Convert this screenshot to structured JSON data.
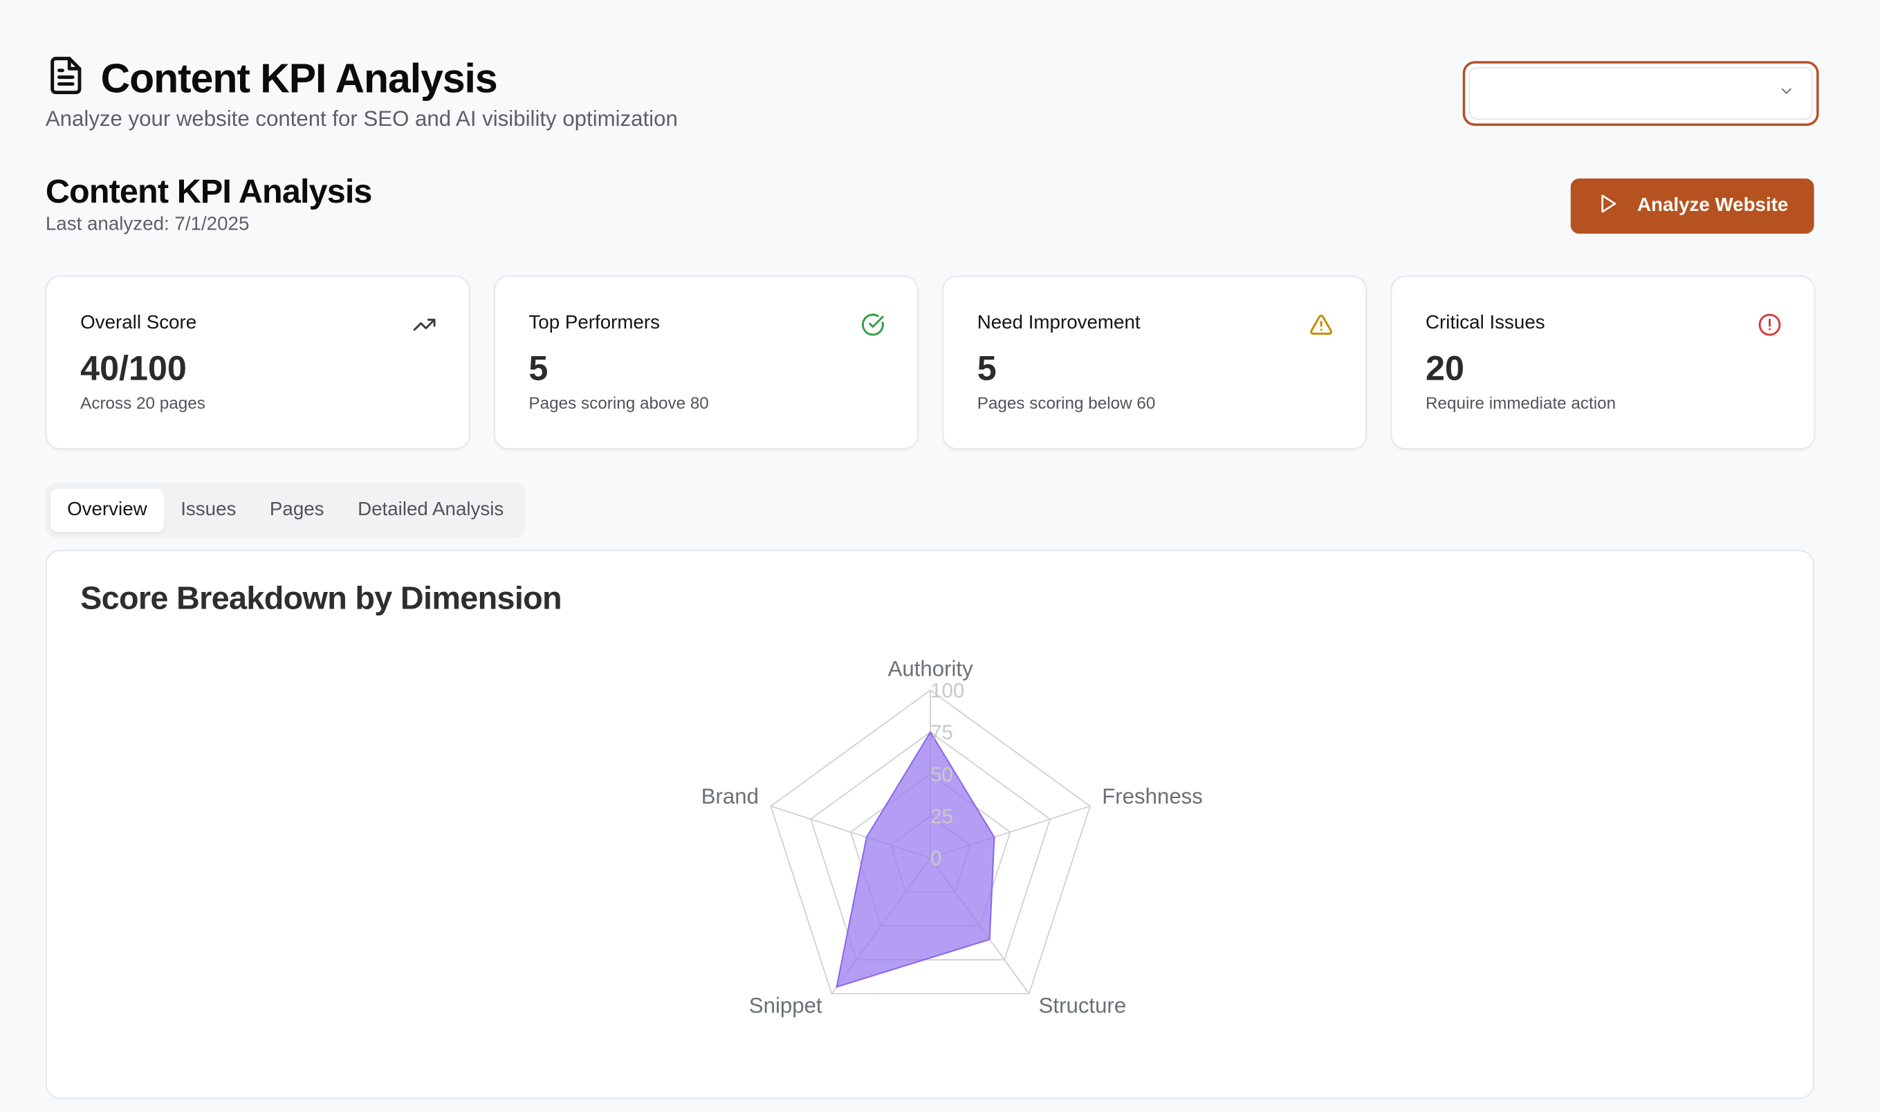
{
  "header": {
    "title": "Content KPI Analysis",
    "subtitle": "Analyze your website content for SEO and AI visibility optimization",
    "icon": "document-icon"
  },
  "site_select": {
    "value": ""
  },
  "section": {
    "title": "Content KPI Analysis",
    "last_analyzed": "Last analyzed: 7/1/2025",
    "analyze_label": "Analyze Website"
  },
  "cards": [
    {
      "label": "Overall Score",
      "value": "40/100",
      "desc": "Across 20 pages",
      "icon": "trending-up-icon",
      "color": "#3a3a3a"
    },
    {
      "label": "Top Performers",
      "value": "5",
      "desc": "Pages scoring above 80",
      "icon": "check-circle-icon",
      "color": "#2f9e44"
    },
    {
      "label": "Need Improvement",
      "value": "5",
      "desc": "Pages scoring below 60",
      "icon": "warning-triangle-icon",
      "color": "#c58a00"
    },
    {
      "label": "Critical Issues",
      "value": "20",
      "desc": "Require immediate action",
      "icon": "alert-circle-icon",
      "color": "#d63a3a"
    }
  ],
  "tabs": [
    "Overview",
    "Issues",
    "Pages",
    "Detailed Analysis"
  ],
  "active_tab": "Overview",
  "panel": {
    "title": "Score Breakdown by Dimension"
  },
  "colors": {
    "accent": "#b5521f",
    "radar_fill": "#9b7df0",
    "radar_stroke": "#8b67ee"
  },
  "chart_data": {
    "type": "radar",
    "categories": [
      "Authority",
      "Freshness",
      "Structure",
      "Snippet",
      "Brand"
    ],
    "series": [
      {
        "values": [
          75,
          40,
          60,
          95,
          40
        ]
      }
    ],
    "rlim": [
      0,
      100
    ],
    "ticks": [
      "0",
      "25",
      "50",
      "75",
      "100"
    ]
  }
}
